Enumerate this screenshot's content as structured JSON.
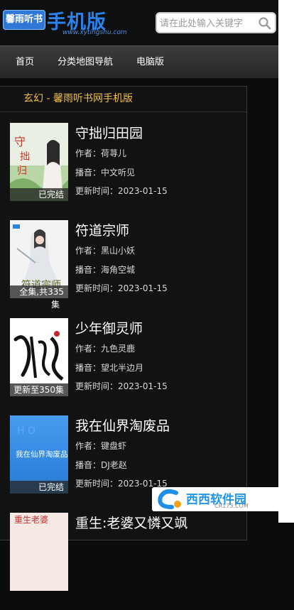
{
  "header": {
    "logo_text": "馨雨听书",
    "logo_title": "手机版",
    "logo_url": "www.xytingshu.com",
    "search_placeholder": "请在此处输入关键字"
  },
  "nav": {
    "items": [
      "首页",
      "分类地图导航",
      "电脑版"
    ]
  },
  "section_title": "玄幻 - 馨雨听书网手机版",
  "books": [
    {
      "title": "守拙归田园",
      "author": "作者：荷荨儿",
      "narrator": "播音：中文听见",
      "updated": "更新时间：2023-01-15",
      "badge": "已完结",
      "badge_extra": ""
    },
    {
      "title": "符道宗师",
      "author": "作者：黑山小妖",
      "narrator": "播音：海角空城",
      "updated": "更新时间：2023-01-15",
      "badge": "全集,共335",
      "badge_extra": "集"
    },
    {
      "title": "少年御灵师",
      "author": "作者：九色灵鹿",
      "narrator": "播音：望北半边月",
      "updated": "更新时间：2023-01-15",
      "badge": "更新至350集",
      "badge_extra": ""
    },
    {
      "title": "我在仙界淘废品",
      "author": "作者：键盘虾",
      "narrator": "播音：DJ老赵",
      "updated": "更新时间：2023-01-15",
      "badge": "已完结",
      "badge_extra": ""
    },
    {
      "title": "重生:老婆又憐又飒",
      "author": "",
      "narrator": "",
      "updated": "",
      "badge": "",
      "badge_extra": ""
    }
  ],
  "watermark": {
    "text": "西西软件园",
    "sub": "CR173.COM"
  }
}
